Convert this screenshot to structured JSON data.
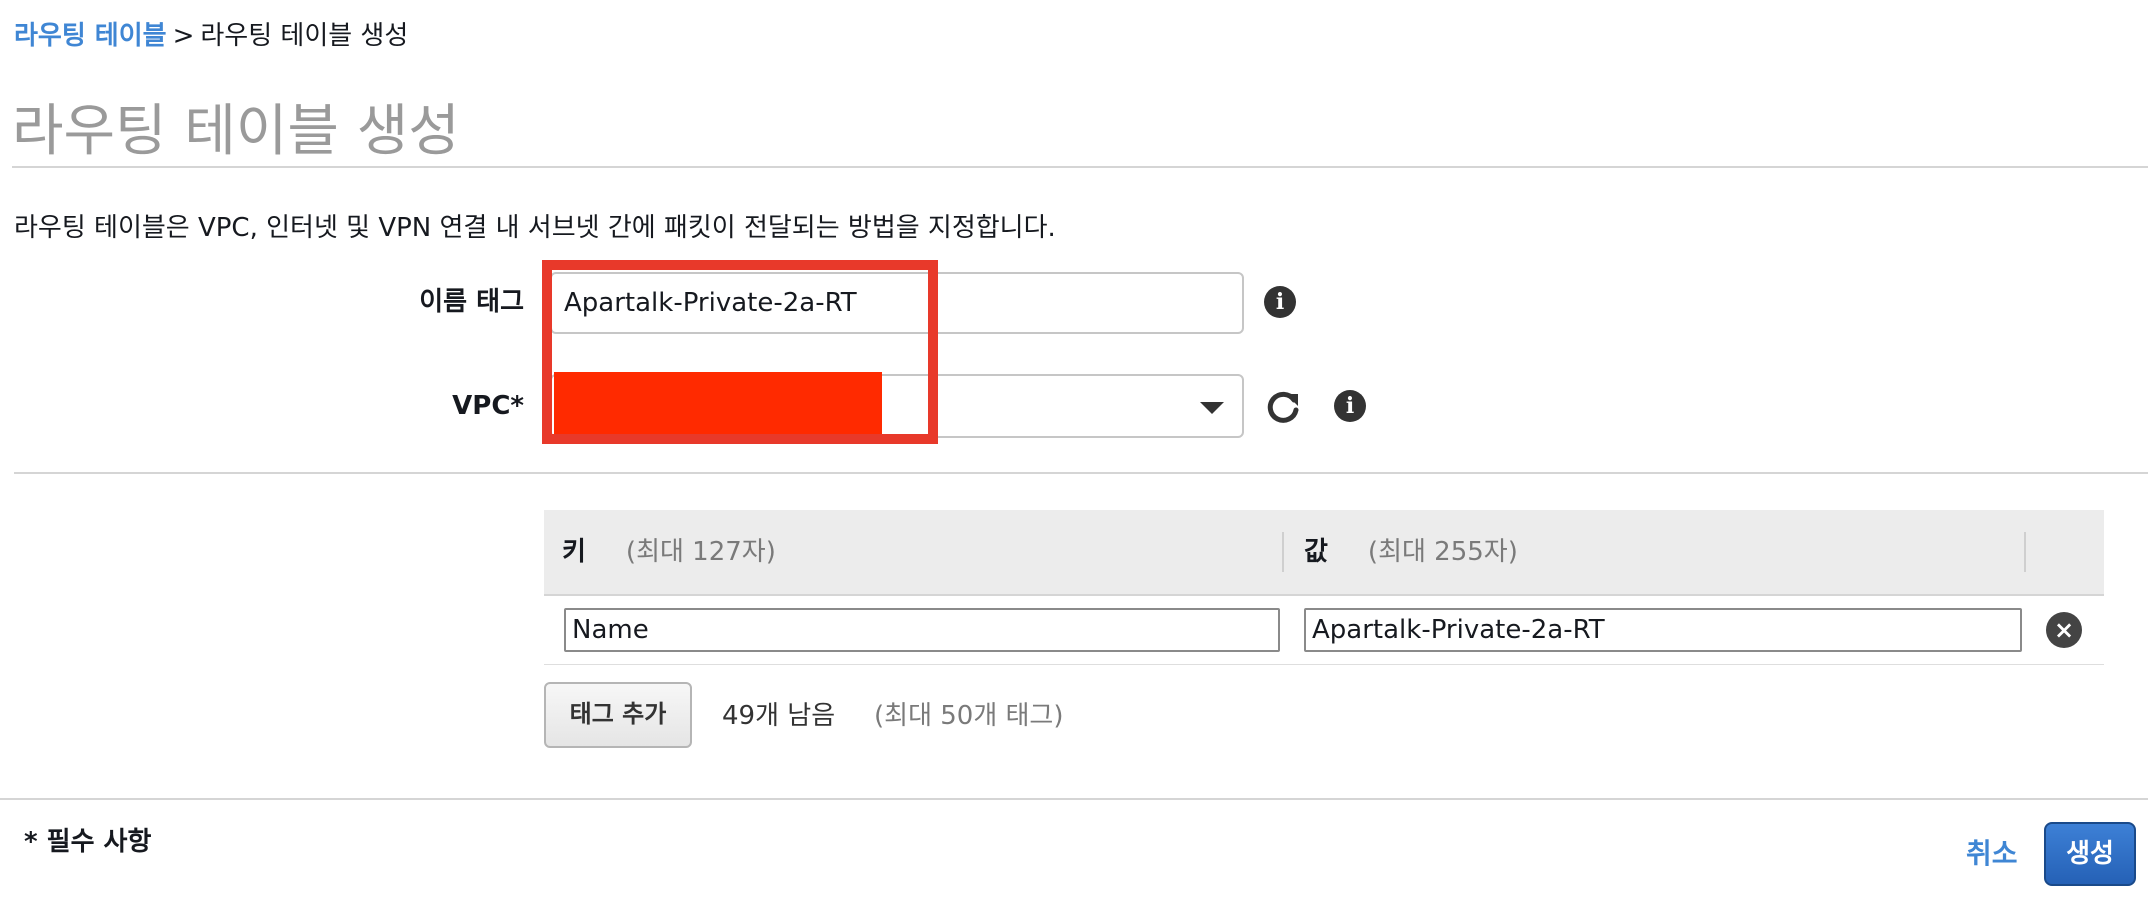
{
  "breadcrumb": {
    "parent": "라우팅 테이블",
    "separator": ">",
    "current": "라우팅 테이블 생성"
  },
  "page": {
    "title": "라우팅 테이블 생성",
    "description": "라우팅 테이블은 VPC, 인터넷 및 VPN 연결 내 서브넷 간에 패킷이 전달되는 방법을 지정합니다."
  },
  "form": {
    "name_tag_label": "이름 태그",
    "name_tag_value": "Apartalk-Private-2a-RT",
    "vpc_label": "VPC*"
  },
  "tags": {
    "key_header": "키",
    "key_hint": "(최대 127자)",
    "value_header": "값",
    "value_hint": "(최대 255자)",
    "rows": [
      {
        "key": "Name",
        "value": "Apartalk-Private-2a-RT"
      }
    ],
    "add_button": "태그 추가",
    "remaining": "49개 남음",
    "max": "(최대 50개 태그)"
  },
  "footer": {
    "required_note": "* 필수 사항",
    "cancel": "취소",
    "create": "생성"
  },
  "icons": {
    "info": "info-icon",
    "refresh": "refresh-icon",
    "caret": "chevron-down-icon",
    "remove": "close-circle-icon"
  },
  "colors": {
    "link": "#3f86d4",
    "primary_button": "#2561b6",
    "redaction": "#ff2a00",
    "highlight": "#e8392a"
  }
}
